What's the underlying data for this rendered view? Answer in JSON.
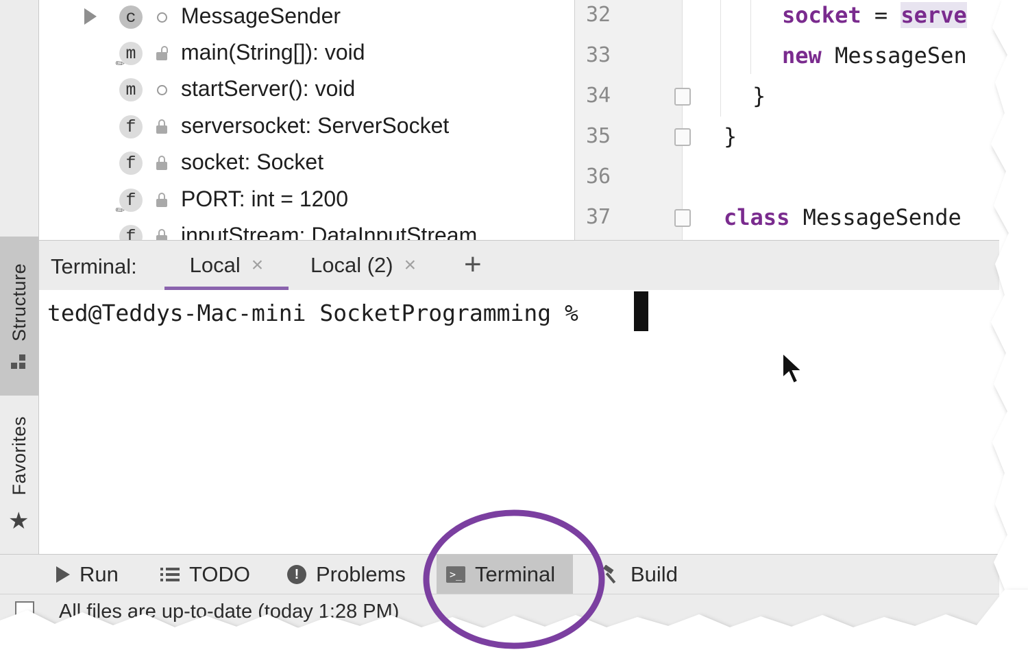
{
  "sidebar": {
    "structure_label": "Structure",
    "favorites_label": "Favorites"
  },
  "structure": {
    "items": [
      {
        "badge": "c",
        "name": "MessageSender"
      },
      {
        "badge": "m",
        "name": "main(String[]): void"
      },
      {
        "badge": "m",
        "name": "startServer(): void"
      },
      {
        "badge": "f",
        "name": "serversocket: ServerSocket"
      },
      {
        "badge": "f",
        "name": "socket: Socket"
      },
      {
        "badge": "f",
        "name": "PORT: int = 1200"
      },
      {
        "badge": "f",
        "name": "inputStream: DataInputStream"
      }
    ]
  },
  "editor": {
    "line_numbers": [
      "32",
      "33",
      "34",
      "35",
      "36",
      "37"
    ],
    "line32_kw": "socket",
    "line32_eq": " = ",
    "line32_hl": "serve",
    "line33_kw": "new",
    "line33_rest": " MessageSen",
    "line34": "}",
    "line35": "}",
    "line37_kw": "class",
    "line37_rest": " MessageSende"
  },
  "terminal": {
    "title": "Terminal:",
    "tabs": [
      "Local",
      "Local (2)"
    ],
    "close_glyph": "×",
    "add_glyph": "+",
    "prompt": "ted@Teddys-Mac-mini SocketProgramming % "
  },
  "toolbar": {
    "items": [
      "Run",
      "TODO",
      "Problems",
      "Terminal",
      "Build"
    ],
    "active": "Terminal"
  },
  "status": {
    "message": "All files are up-to-date (today 1:28 PM)"
  },
  "colors": {
    "accent": "#7b3fa0",
    "keyword": "#7a2b8e"
  },
  "icons": [
    "triangle-right-icon",
    "class-icon",
    "method-icon",
    "field-icon",
    "lock-icon",
    "star-icon",
    "list-icon",
    "terminal-icon",
    "hammer-icon",
    "mouse-cursor-icon"
  ]
}
